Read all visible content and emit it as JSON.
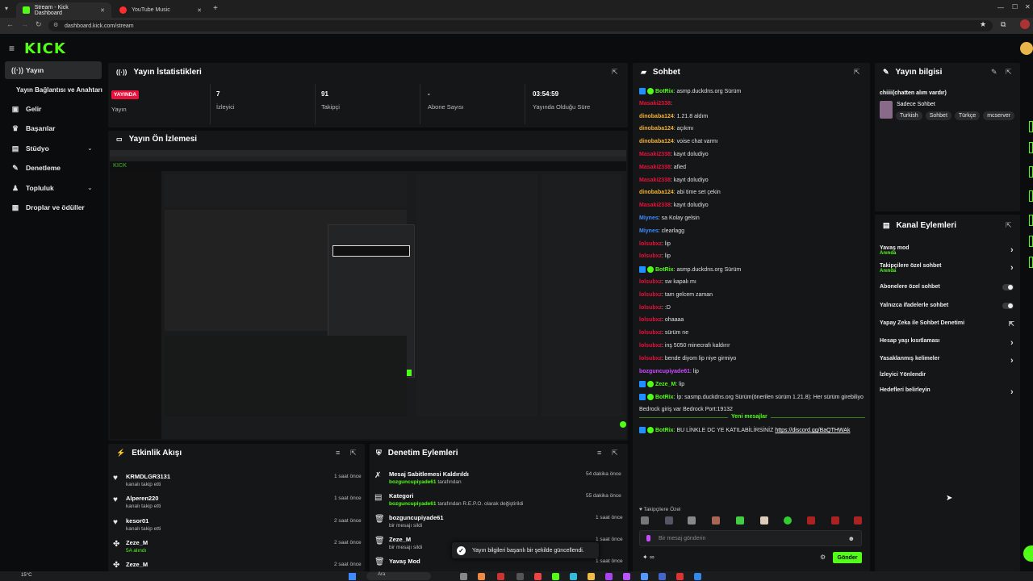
{
  "browser": {
    "tabs": [
      {
        "label": "Stream - Kick Dashboard",
        "color": "#53fc18"
      },
      {
        "label": "YouTube Music",
        "color": "#ff2d2d"
      }
    ],
    "url": "dashboard.kick.com/stream"
  },
  "brand": {
    "logo": "KICK",
    "accent": "#53fc18"
  },
  "sidebar": {
    "items": [
      {
        "label": "Yayın",
        "icon": "broadcast-icon"
      },
      {
        "label": "Yayın Bağlantısı ve Anahtarı",
        "icon": ""
      },
      {
        "label": "Gelir",
        "icon": "wallet-icon"
      },
      {
        "label": "Başarılar",
        "icon": "trophy-icon"
      },
      {
        "label": "Stüdyo",
        "icon": "studio-icon"
      },
      {
        "label": "Denetleme",
        "icon": "wrench-icon"
      },
      {
        "label": "Topluluk",
        "icon": "community-icon"
      },
      {
        "label": "Droplar ve ödüller",
        "icon": "gift-icon"
      }
    ]
  },
  "stats": {
    "title": "Yayın İstatistikleri",
    "items": [
      {
        "value": "YAYINDA",
        "label": "Yayın"
      },
      {
        "value": "7",
        "label": "İzleyici"
      },
      {
        "value": "91",
        "label": "Takipçi"
      },
      {
        "value": "-",
        "label": "Abone Sayısı"
      },
      {
        "value": "03:54:59",
        "label": "Yayında Olduğu Süre"
      }
    ]
  },
  "preview": {
    "title": "Yayın Ön İzlemesi"
  },
  "activity": {
    "title": "Etkinlik Akışı",
    "items": [
      {
        "name": "KRMDLGR3131",
        "sub": "kanalı takip etti",
        "time": "1 saat önce",
        "icon": "heart-icon"
      },
      {
        "name": "Alperen220",
        "sub": "kanalı takip etti",
        "time": "1 saat önce",
        "icon": "heart-icon"
      },
      {
        "name": "kesor01",
        "sub": "kanalı takip etti",
        "time": "2 saat önce",
        "icon": "heart-icon"
      },
      {
        "name": "Zeze_M",
        "sub": "5A alındı",
        "time": "2 saat önce",
        "icon": "gift-icon"
      },
      {
        "name": "Zeze_M",
        "sub": "",
        "time": "2 saat önce",
        "icon": "gift-icon"
      }
    ]
  },
  "moderation": {
    "title": "Denetim Eylemleri",
    "items": [
      {
        "name": "Mesaj Sabitlemesi Kaldırıldı",
        "user": "bozguncupiyade61",
        "rest": " tarafından",
        "time": "54 dakika önce",
        "icon": "unpin-icon"
      },
      {
        "name": "Kategori",
        "user": "bozguncupiyade61",
        "rest": " tarafından R.E.P.O. olarak değiştirildi",
        "time": "55 dakika önce",
        "icon": "category-icon"
      },
      {
        "name": "bozguncupiyade61",
        "user": "",
        "rest": "bir mesajı sildi",
        "time": "1 saat önce",
        "icon": "trash-icon"
      },
      {
        "name": "Zeze_M",
        "user": "",
        "rest": "bir mesajı sildi",
        "time": "1 saat önce",
        "icon": "trash-icon"
      },
      {
        "name": "Yavaş Mod",
        "user": "",
        "rest": "",
        "time": "1 saat önce",
        "icon": "trash-icon"
      }
    ]
  },
  "toast": {
    "text": "Yayın bilgileri başarılı bir şekilde güncellendi."
  },
  "chat": {
    "title": "Sohbet",
    "messages": [
      {
        "user": "BotRix",
        "color": "#53fc18",
        "text": ": asmp.duckdns.org Sürüm",
        "bot": true
      },
      {
        "user": "Masaki2338",
        "color": "#e9113c",
        "text": ":"
      },
      {
        "user": "dinobaba124",
        "color": "#f2b134",
        "text": ": 1.21.8 aldım"
      },
      {
        "user": "dinobaba124",
        "color": "#f2b134",
        "text": ": açıkmı"
      },
      {
        "user": "dinobaba124",
        "color": "#f2b134",
        "text": ": voise chat varmı"
      },
      {
        "user": "Masaki2338",
        "color": "#e9113c",
        "text": ": kayıt doludiyo"
      },
      {
        "user": "Masaki2338",
        "color": "#e9113c",
        "text": ": afied"
      },
      {
        "user": "Masaki2338",
        "color": "#e9113c",
        "text": ": kayıt doludiyo"
      },
      {
        "user": "dinobaba124",
        "color": "#f2b134",
        "text": ": abi time set çekin"
      },
      {
        "user": "Masaki2338",
        "color": "#e9113c",
        "text": ": kayıt doludiyo"
      },
      {
        "user": "Miynes",
        "color": "#3d8bff",
        "text": ": sa Kolay gelsin"
      },
      {
        "user": "Miynes",
        "color": "#3d8bff",
        "text": ": clearlagg"
      },
      {
        "user": "lolsubxz",
        "color": "#e9113c",
        "text": ": lip"
      },
      {
        "user": "lolsubxz",
        "color": "#e9113c",
        "text": ": lip"
      },
      {
        "user": "BotRix",
        "color": "#53fc18",
        "text": ": asmp.duckdns.org Sürüm",
        "bot": true
      },
      {
        "user": "lolsubxz",
        "color": "#e9113c",
        "text": ": sw kapalı mı"
      },
      {
        "user": "lolsubxz",
        "color": "#e9113c",
        "text": ": tam gelcem zaman"
      },
      {
        "user": "lolsubxz",
        "color": "#e9113c",
        "text": ": :D"
      },
      {
        "user": "lolsubxz",
        "color": "#e9113c",
        "text": ": ohaaaa"
      },
      {
        "user": "lolsubxz",
        "color": "#e9113c",
        "text": ": sürüm ne"
      },
      {
        "user": "lolsubxz",
        "color": "#e9113c",
        "text": ": inş 5050 minecrafı kaldırır"
      },
      {
        "user": "lolsubxz",
        "color": "#e9113c",
        "text": ": bende diyom lip niye girmiyo"
      },
      {
        "user": "bozguncupiyade61",
        "color": "#c84bff",
        "text": ": lip"
      },
      {
        "user": "Zeze_M",
        "color": "#53fc18",
        "text": ": lip",
        "bot": true
      },
      {
        "user": "BotRix",
        "color": "#53fc18",
        "text": ": İp: sasmp.duckdns.org Sürüm(önerilen sürüm 1.21.8): Her sürüm girebiliyo",
        "bot": true
      },
      {
        "user": "",
        "color": "#e0e0e0",
        "text": "Bedrock giriş var Bedrock Port:19132"
      }
    ],
    "divider": "Yeni mesajlar",
    "last": {
      "user": "BotRix",
      "text": ": BU LİNKLE DC YE KATILABİLİRSİNİZ ",
      "link": "https://discord.gg/BaQTHWAk"
    },
    "followers_label": "Takipçilere Özel",
    "input_placeholder": "Bir mesaj gönderin",
    "send_label": "Gönder",
    "points": "∞"
  },
  "stream_info": {
    "title": "Yayın bilgisi",
    "stream_title": "chiiii(chatten alım vardır)",
    "category": "Sadece Sohbet",
    "tags": [
      "Turkish",
      "Sohbet",
      "Türkçe",
      "mcserver"
    ]
  },
  "channel_actions": {
    "title": "Kanal Eylemleri",
    "items": [
      {
        "label": "Yavaş mod",
        "sub": "Anında",
        "control": "chevron"
      },
      {
        "label": "Takipçilere özel sohbet",
        "sub": "Anında",
        "control": "chevron"
      },
      {
        "label": "Abonelere özel sohbet",
        "sub": "",
        "control": "toggle"
      },
      {
        "label": "Yalnızca ifadelerle sohbet",
        "sub": "",
        "control": "toggle"
      },
      {
        "label": "Yapay Zeka ile Sohbet Denetimi",
        "sub": "",
        "control": "external"
      },
      {
        "label": "Hesap yaşı kısıtlaması",
        "sub": "",
        "control": "chevron"
      },
      {
        "label": "Yasaklanmış kelimeler",
        "sub": "",
        "control": "chevron"
      },
      {
        "label": "İzleyici Yönlendir",
        "sub": "",
        "control": "none"
      },
      {
        "label": "Hedefleri belirleyin",
        "sub": "",
        "control": "chevron"
      }
    ]
  },
  "taskbar": {
    "weather": "15°C",
    "search": "Ara"
  }
}
